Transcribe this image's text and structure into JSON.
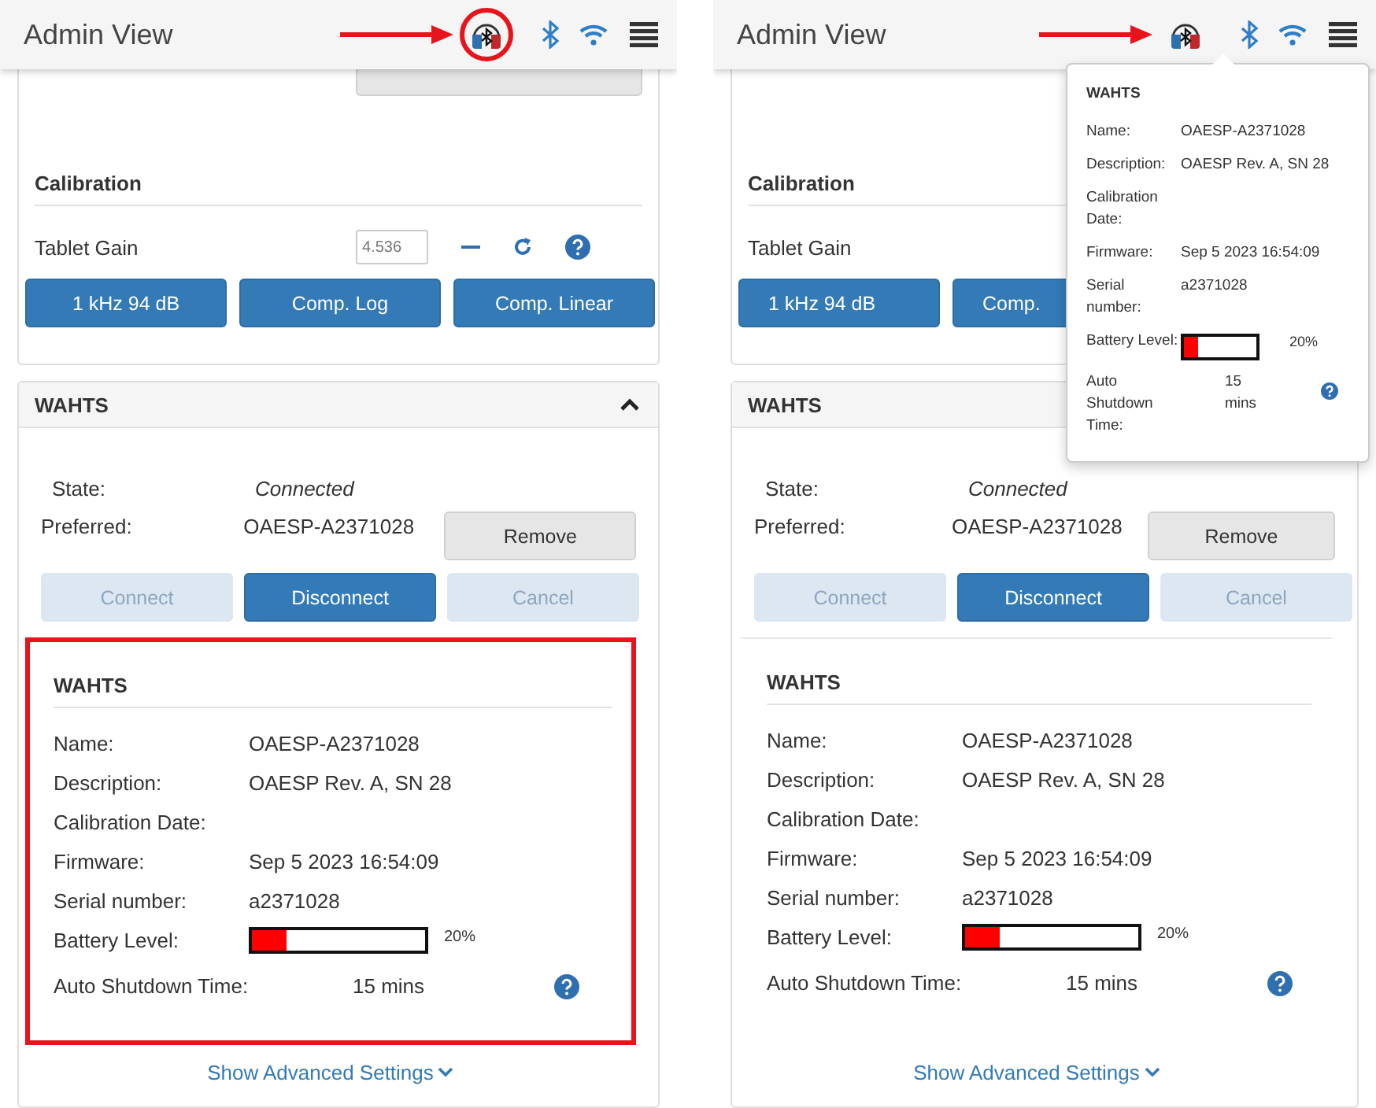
{
  "panels": [
    {
      "header": {
        "title": "Admin View",
        "arrow": true,
        "headset_circled": true
      },
      "calibration": {
        "title": "Calibration",
        "gain_label": "Tablet Gain",
        "gain_value": "4.536",
        "buttons": [
          "1 kHz 94 dB",
          "Comp. Log",
          "Comp. Linear"
        ]
      },
      "wahts": {
        "title": "WAHTS",
        "chevron": true,
        "state_label": "State:",
        "state": "Connected",
        "preferred_label": "Preferred:",
        "preferred": "OAESP-A2371028",
        "remove": "Remove",
        "buttons": [
          {
            "label": "Connect",
            "disabled": true
          },
          {
            "label": "Disconnect",
            "disabled": false
          },
          {
            "label": "Cancel",
            "disabled": true
          }
        ],
        "info": {
          "title": "WAHTS",
          "highlighted": true,
          "rows": [
            {
              "kind": "text",
              "label": "Name:",
              "value": "OAESP-A2371028"
            },
            {
              "kind": "text",
              "label": "Description:",
              "value": "OAESP Rev. A, SN 28"
            },
            {
              "kind": "text",
              "label": "Calibration Date:"
            },
            {
              "kind": "text",
              "label": "Firmware:",
              "value": "Sep 5 2023 16:54:09"
            },
            {
              "kind": "text",
              "label": "Serial number:",
              "value": "a2371028"
            },
            {
              "kind": "battery",
              "label": "Battery Level:",
              "level": 0.2,
              "reading": "20%"
            },
            {
              "kind": "timer",
              "label": "Auto Shutdown Time:",
              "value": "15 mins"
            }
          ]
        },
        "advanced": "Show Advanced Settings"
      }
    },
    {
      "header": {
        "title": "Admin View",
        "arrow": true,
        "headset_circled": false
      },
      "calibration": {
        "title": "Calibration",
        "gain_label": "Tablet Gain",
        "buttons": [
          "1 kHz 94 dB",
          "Comp."
        ]
      },
      "wahts": {
        "title": "WAHTS",
        "state_label": "State:",
        "state": "Connected",
        "preferred_label": "Preferred:",
        "preferred": "OAESP-A2371028",
        "remove": "Remove",
        "buttons": [
          {
            "label": "Connect",
            "disabled": true
          },
          {
            "label": "Disconnect",
            "disabled": false
          },
          {
            "label": "Cancel",
            "disabled": true
          }
        ],
        "info": {
          "title": "WAHTS",
          "highlighted": false,
          "rows": [
            {
              "kind": "text",
              "label": "Name:",
              "value": "OAESP-A2371028"
            },
            {
              "kind": "text",
              "label": "Description:",
              "value": "OAESP Rev. A, SN 28"
            },
            {
              "kind": "text",
              "label": "Calibration Date:"
            },
            {
              "kind": "text",
              "label": "Firmware:",
              "value": "Sep 5 2023 16:54:09"
            },
            {
              "kind": "text",
              "label": "Serial number:",
              "value": "a2371028"
            },
            {
              "kind": "battery",
              "label": "Battery Level:",
              "level": 0.2,
              "reading": "20%"
            },
            {
              "kind": "timer",
              "label": "Auto Shutdown Time:",
              "value": "15 mins"
            }
          ]
        },
        "advanced": "Show Advanced Settings"
      },
      "popover": {
        "title": "WAHTS",
        "rows": [
          {
            "kind": "text",
            "label": "Name:",
            "value": "OAESP-A2371028"
          },
          {
            "kind": "text",
            "label": "Description:",
            "value": "OAESP Rev. A, SN 28"
          },
          {
            "kind": "text",
            "label": "Calibration Date:"
          },
          {
            "kind": "text",
            "label": "Firmware:",
            "value": "Sep 5 2023 16:54:09"
          },
          {
            "kind": "text",
            "label": "Serial number:",
            "value": "a2371028"
          },
          {
            "kind": "battery",
            "label": "Battery Level:",
            "level": 0.2,
            "reading": "20%"
          },
          {
            "kind": "timer",
            "label": "Auto Shutdown Time:",
            "value": "15 mins"
          }
        ]
      }
    }
  ]
}
